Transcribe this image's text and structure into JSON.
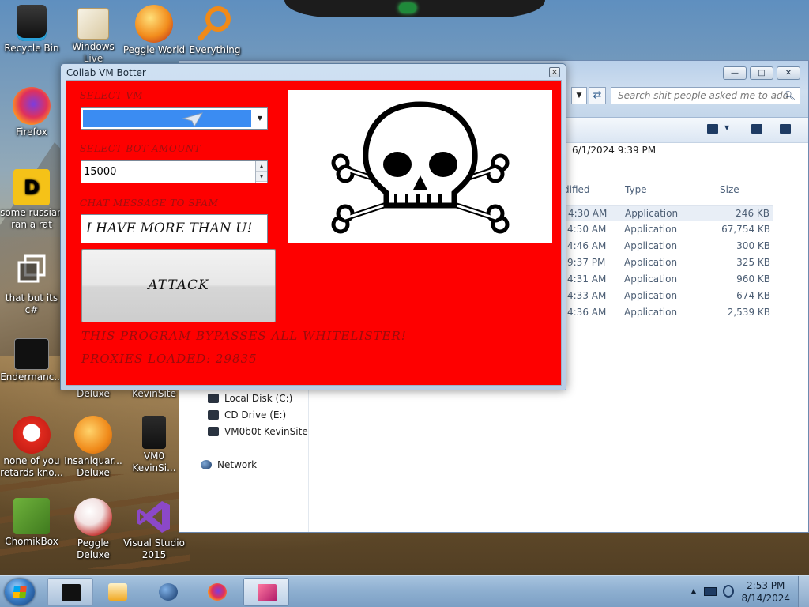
{
  "desktop": {
    "icons": [
      {
        "label": "Recycle Bin"
      },
      {
        "label": "Windows Live"
      },
      {
        "label": "Peggle World"
      },
      {
        "label": "Everything"
      },
      {
        "label": "Firefox"
      },
      {
        "label": "some russian ran a rat"
      },
      {
        "label": "that but its c#"
      },
      {
        "label": "Endermanc..."
      },
      {
        "label": "Deluxe"
      },
      {
        "label": "KevinSite"
      },
      {
        "label": "none of you retards kno..."
      },
      {
        "label": "Insaniquar... Deluxe"
      },
      {
        "label": "VM0 KevinSi..."
      },
      {
        "label": "ChomikBox"
      },
      {
        "label": "Peggle Deluxe"
      },
      {
        "label": "Visual Studio 2015"
      }
    ]
  },
  "explorer": {
    "search_placeholder": "Search shit people asked me to add",
    "date_text": "6/1/2024 9:39 PM",
    "columns": {
      "modified": "dified",
      "type": "Type",
      "size": "Size"
    },
    "files": [
      {
        "time": "4:30 AM",
        "type": "Application",
        "size": "246 KB"
      },
      {
        "time": "4:50 AM",
        "type": "Application",
        "size": "67,754 KB"
      },
      {
        "time": "4:46 AM",
        "type": "Application",
        "size": "300 KB"
      },
      {
        "time": "9:37 PM",
        "type": "Application",
        "size": "325 KB"
      },
      {
        "time": "4:31 AM",
        "type": "Application",
        "size": "960 KB"
      },
      {
        "time": "4:33 AM",
        "type": "Application",
        "size": "674 KB"
      },
      {
        "time": "4:36 AM",
        "type": "Application",
        "size": "2,539 KB"
      }
    ],
    "nav": {
      "local_disk": "Local Disk (C:)",
      "cd_drive": "CD Drive (E:)",
      "vm_site": "VM0b0t KevinSite",
      "network": "Network"
    }
  },
  "botter": {
    "title": "Collab VM Botter",
    "close_glyph": "×",
    "select_vm_label": "SELECT VM",
    "bot_amount_label": "SELECT BOT AMOUNT",
    "bot_amount_value": "15000",
    "chat_label": "CHAT MESSAGE TO SPAM",
    "chat_value": "I HAVE MORE THAN U!",
    "attack_label": "ATTACK",
    "bypass_text": "THIS PROGRAM BYPASSES ALL WHITELISTER!",
    "proxies_text": "PROXIES LOADED: 29835"
  },
  "taskbar": {
    "time": "2:53 PM",
    "date": "8/14/2024"
  },
  "colors": {
    "botter_background": "#fe0000",
    "select_fill": "#3b8cf2"
  }
}
